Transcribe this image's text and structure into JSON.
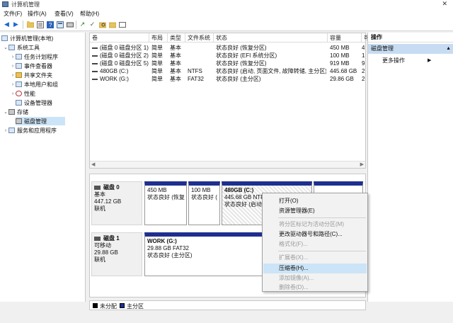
{
  "window": {
    "title": "计算机管理",
    "close_glyph": "✕"
  },
  "menubar": [
    {
      "label": "文件(F)"
    },
    {
      "label": "操作(A)"
    },
    {
      "label": "查看(V)"
    },
    {
      "label": "帮助(H)"
    }
  ],
  "toolbar": {
    "icons": [
      "back-icon",
      "forward-icon",
      "up-folder-icon",
      "properties-icon",
      "help-icon",
      "list-icon",
      "connect-icon",
      "check-icon",
      "search-icon",
      "disk-icon"
    ]
  },
  "tree": {
    "root": "计算机管理(本地)",
    "system_tools": "系统工具",
    "task_scheduler": "任务计划程序",
    "event_viewer": "事件查看器",
    "shared_folders": "共享文件夹",
    "local_users": "本地用户和组",
    "performance": "性能",
    "device_manager": "设备管理器",
    "storage": "存储",
    "disk_management": "磁盘管理",
    "services_apps": "服务和应用程序"
  },
  "volumes": {
    "headers": [
      "卷",
      "布局",
      "类型",
      "文件系统",
      "状态",
      "容量",
      "可"
    ],
    "rows": [
      {
        "name": "(磁盘 0 磁盘分区 1)",
        "layout": "简单",
        "type": "基本",
        "fs": "",
        "status": "状态良好 (恢复分区)",
        "capacity": "450 MB",
        "free": "4"
      },
      {
        "name": "(磁盘 0 磁盘分区 2)",
        "layout": "简单",
        "type": "基本",
        "fs": "",
        "status": "状态良好 (EFI 系统分区)",
        "capacity": "100 MB",
        "free": "1"
      },
      {
        "name": "(磁盘 0 磁盘分区 5)",
        "layout": "简单",
        "type": "基本",
        "fs": "",
        "status": "状态良好 (恢复分区)",
        "capacity": "919 MB",
        "free": "9"
      },
      {
        "name": "480GB (C:)",
        "layout": "简单",
        "type": "基本",
        "fs": "NTFS",
        "status": "状态良好 (启动, 页面文件, 故障转储, 主分区)",
        "capacity": "445.68 GB",
        "free": "2"
      },
      {
        "name": "WORK (G:)",
        "layout": "简单",
        "type": "基本",
        "fs": "FAT32",
        "status": "状态良好 (主分区)",
        "capacity": "29.86 GB",
        "free": "2"
      }
    ]
  },
  "disks": {
    "disk0": {
      "title": "磁盘 0",
      "type": "基本",
      "size": "447.12 GB",
      "state": "联机",
      "partitions": [
        {
          "name": "",
          "size": "450 MB",
          "status": "状态良好 (恢复"
        },
        {
          "name": "",
          "size": "100 MB",
          "status": "状态良好 ("
        },
        {
          "name": "480GB  (C:)",
          "size": "445.68 GB NTFS",
          "status": "状态良好 (启动"
        },
        {
          "name": "",
          "size": "",
          "status": ""
        }
      ]
    },
    "disk1": {
      "title": "磁盘 1",
      "type": "可移动",
      "size": "29.88 GB",
      "state": "联机",
      "partitions": [
        {
          "name": "WORK  (G:)",
          "size": "29.88 GB FAT32",
          "status": "状态良好 (主分区)"
        }
      ]
    }
  },
  "legend": {
    "unallocated": "未分配",
    "primary": "主分区",
    "unallocated_color": "#000000",
    "primary_color": "#1e2f8f"
  },
  "actions": {
    "title": "操作",
    "section": "磁盘管理",
    "more": "更多操作"
  },
  "context_menu": {
    "open": "打开(O)",
    "explore": "资源管理器(E)",
    "mark_active": "将分区标记为活动分区(M)",
    "change_letter": "更改驱动器号和路径(C)...",
    "format": "格式化(F)...",
    "extend": "扩展卷(X)...",
    "shrink": "压缩卷(H)...",
    "add_mirror": "添加镜像(A)...",
    "delete": "删除卷(D)..."
  }
}
